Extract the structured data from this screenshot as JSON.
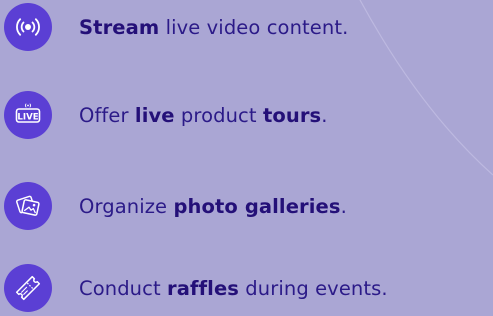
{
  "features": [
    {
      "icon": "broadcast-icon",
      "parts": [
        "",
        "Stream",
        " live video content."
      ]
    },
    {
      "icon": "live-badge-icon",
      "icon_text": "LIVE",
      "parts": [
        "Offer ",
        "live",
        " product ",
        "tours",
        "."
      ]
    },
    {
      "icon": "photo-gallery-icon",
      "parts": [
        "Organize ",
        "photo galleries",
        "."
      ]
    },
    {
      "icon": "ticket-icon",
      "parts": [
        "Conduct ",
        "raffles",
        " during events."
      ]
    }
  ],
  "colors": {
    "background": "#aaa6d4",
    "icon_badge": "#5b3fd4",
    "text": "#2b1a88"
  }
}
